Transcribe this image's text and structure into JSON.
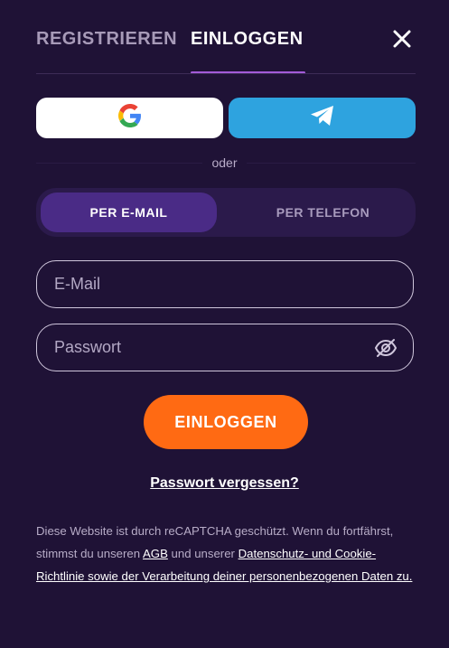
{
  "tabs": {
    "register_label": "REGISTRIEREN",
    "login_label": "EINLOGGEN",
    "active": "login"
  },
  "icons": {
    "close": "close-icon",
    "google": "google-icon",
    "telegram": "telegram-icon",
    "password_toggle": "eye-off-icon"
  },
  "divider": {
    "or_label": "oder"
  },
  "method_toggle": {
    "email_label": "PER E-MAIL",
    "phone_label": "PER TELEFON",
    "selected": "email"
  },
  "form": {
    "email_placeholder": "E-Mail",
    "email_value": "",
    "password_placeholder": "Passwort",
    "password_value": "",
    "submit_label": "EINLOGGEN",
    "forgot_label": "Passwort vergessen?"
  },
  "legal": {
    "text_before_agb": "Diese Website ist durch reCAPTCHA geschützt. Wenn du fortfährst, stimmst du unseren ",
    "agb_link": "AGB",
    "text_between": " und unserer ",
    "privacy_link": "Datenschutz- und Cookie-Richtlinie sowie der Verarbeitung deiner personenbezogenen Daten zu."
  },
  "colors": {
    "background": "#1f1236",
    "accent_underline": "#a35bd8",
    "submit_orange": "#ff6a13",
    "telegram_blue": "#2ea3df",
    "toggle_active": "#4a2b86"
  }
}
